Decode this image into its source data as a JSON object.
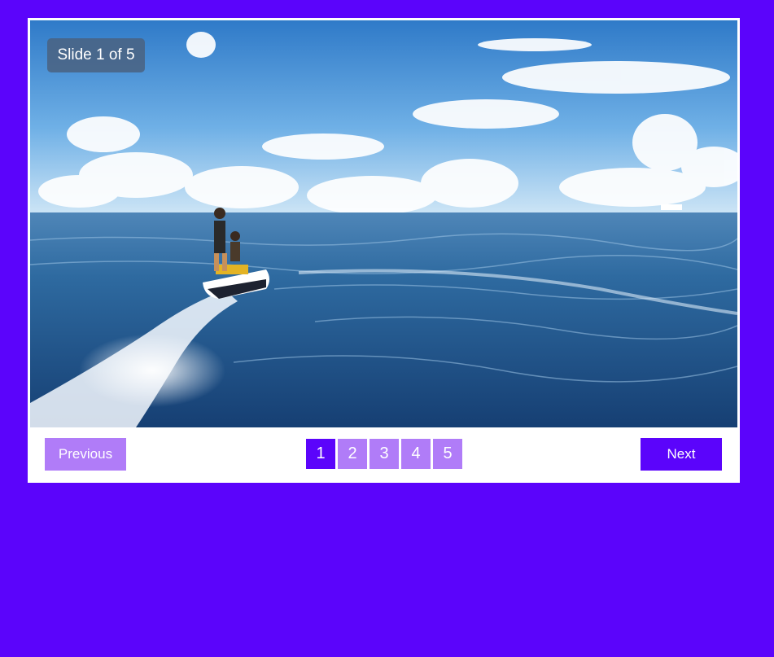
{
  "slider": {
    "counter_text": "Slide 1 of 5",
    "current_slide": 1,
    "total_slides": 5,
    "image_alt": "Person riding a jet ski on the ocean under a blue sky with clouds",
    "prev_label": "Previous",
    "next_label": "Next",
    "pages": [
      "1",
      "2",
      "3",
      "4",
      "5"
    ],
    "active_page_index": 0
  },
  "colors": {
    "background": "#5b04fb",
    "accent": "#5b04fb",
    "inactive": "#b07cf8",
    "card": "#ffffff",
    "counter_bg": "#4a6280"
  }
}
